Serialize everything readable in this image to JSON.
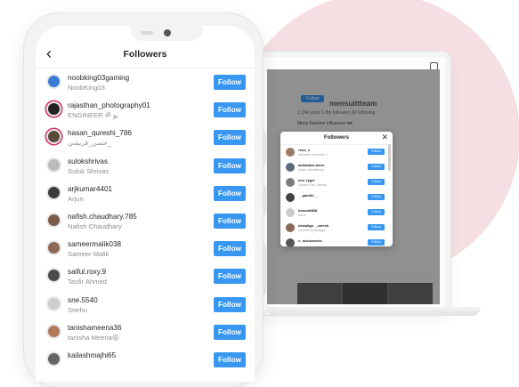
{
  "phone": {
    "title": "Followers",
    "back_icon": "chevron-left-icon",
    "follow_label": "Follow",
    "followers": [
      {
        "username": "noobking03gaming",
        "name": "NoobKing03",
        "ring": false,
        "avatar_color": "#3a7bd5"
      },
      {
        "username": "rajasthan_photography01",
        "name": "ENGINEER ॐ یو",
        "ring": true,
        "avatar_color": "#222222"
      },
      {
        "username": "hasan_qureshi_786",
        "name": "حسن_قريشي_",
        "ring": true,
        "avatar_color": "#5a4a3a"
      },
      {
        "username": "sulokshrivas",
        "name": "Sulok Shrivas",
        "ring": false,
        "avatar_color": "#bbbbbb"
      },
      {
        "username": "arjkumar4401",
        "name": "Arjun",
        "ring": false,
        "avatar_color": "#3b3b3b"
      },
      {
        "username": "nafish.chaudhary.785",
        "name": "Nafish Chaudhary",
        "ring": false,
        "avatar_color": "#7a5c48"
      },
      {
        "username": "sameermalik038",
        "name": "Sameer Malik",
        "ring": false,
        "avatar_color": "#8b6a55"
      },
      {
        "username": "saiful.roxy.9",
        "name": "Tasfir Ahmed",
        "ring": false,
        "avatar_color": "#4a4a4a"
      },
      {
        "username": "sne.5540",
        "name": "Snehu",
        "ring": false,
        "avatar_color": "#cfcfcf"
      },
      {
        "username": "tanishameena36",
        "name": "tanisha Meena😝",
        "ring": false,
        "avatar_color": "#b07a5a"
      },
      {
        "username": "kailashmajhi65",
        "name": "",
        "ring": false,
        "avatar_color": "#666666"
      }
    ]
  },
  "laptop": {
    "profile_name": "mensuittteam",
    "profile_button": "Follow",
    "stats": "2,184 posts      1.8m followers      90 following",
    "bio": "Mens Fashion influencer 🕶",
    "modal": {
      "title": "Followers",
      "close_icon": "close-icon",
      "follow_label": "Follow",
      "rows": [
        {
          "username": "roos_s",
          "name": "rahmatt eoressie ⚡"
        },
        {
          "username": "abdabbas.amer",
          "name": "Amer Abdabbas"
        },
        {
          "username": "emi_tyger",
          "name": "Xauthi Emi Jamsu"
        },
        {
          "username": "__gandhi__",
          "name": ""
        },
        {
          "username": "bimodd888",
          "name": "bims"
        },
        {
          "username": "dewaliga__umesh",
          "name": "Umesh Dewaliga"
        },
        {
          "username": "n_azulsweeks",
          "name": ""
        }
      ]
    }
  },
  "colors": {
    "accent": "#3897f0",
    "blob": "#f6dfe2",
    "story_ring": "#d6336c"
  }
}
